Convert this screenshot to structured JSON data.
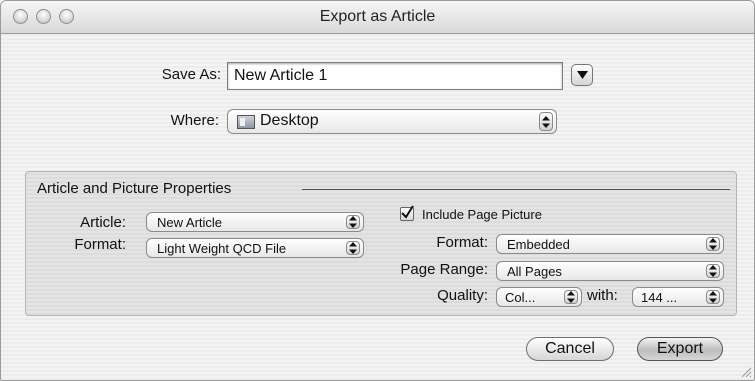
{
  "window": {
    "title": "Export as Article"
  },
  "save_as": {
    "label": "Save As:",
    "value": "New Article 1"
  },
  "where": {
    "label": "Where:",
    "value": "Desktop",
    "icon": "desktop-folder-icon"
  },
  "group": {
    "title": "Article and Picture Properties",
    "article": {
      "label": "Article:",
      "value": "New Article"
    },
    "format": {
      "label": "Format:",
      "value": "Light Weight QCD File"
    },
    "include_page_picture": {
      "label": "Include Page Picture",
      "checked": true
    },
    "picture_format": {
      "label": "Format:",
      "value": "Embedded"
    },
    "page_range": {
      "label": "Page Range:",
      "value": "All Pages"
    },
    "quality": {
      "label": "Quality:",
      "value": "Col...",
      "with_label": "with:",
      "with_value": "144 ..."
    }
  },
  "buttons": {
    "cancel": "Cancel",
    "export": "Export"
  }
}
